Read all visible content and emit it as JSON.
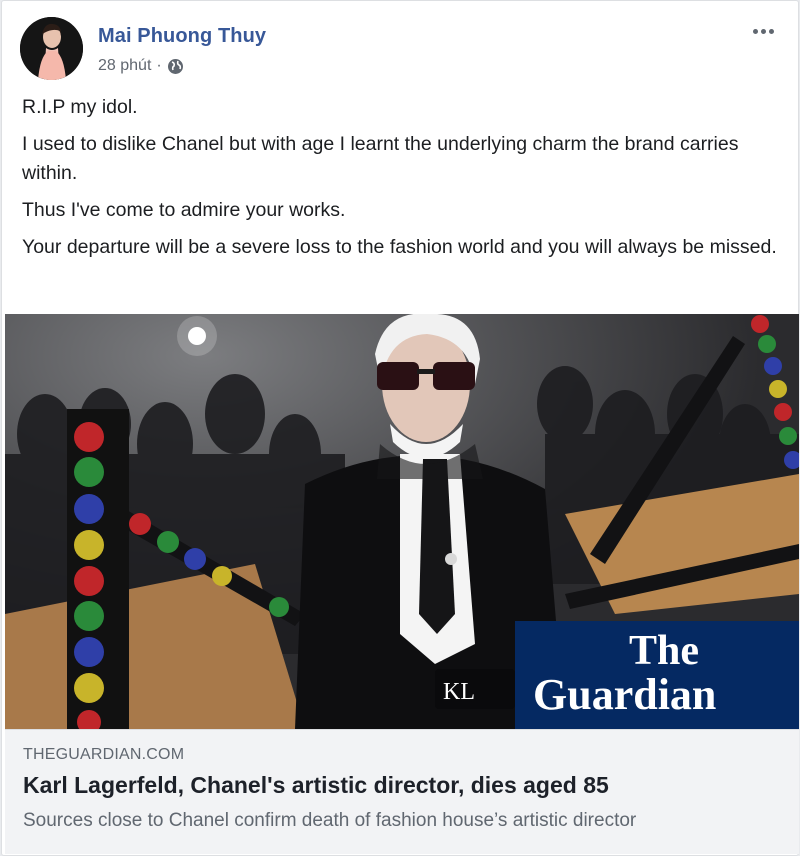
{
  "post": {
    "author": "Mai Phuong Thuy",
    "time": "28 phút",
    "separator": "·",
    "audience_icon": "globe-icon",
    "paragraphs": [
      "R.I.P my idol.",
      "I used to dislike Chanel but with age I learnt the underlying charm the brand carries within.",
      "Thus I've come to admire your works.",
      "Your departure will be a severe loss to the fashion world and you will always be missed."
    ]
  },
  "photo": {
    "watermark_line1": "The",
    "watermark_line2": "Guardian",
    "sign_text": "KL",
    "brand_color": "#052962"
  },
  "link": {
    "domain": "THEGUARDIAN.COM",
    "title": "Karl Lagerfeld, Chanel's artistic director, dies aged 85",
    "description": "Sources close to Chanel confirm death of fashion house’s artistic director"
  },
  "colors": {
    "author": "#385898",
    "muted": "#606770",
    "link_bg": "#f2f3f5"
  }
}
